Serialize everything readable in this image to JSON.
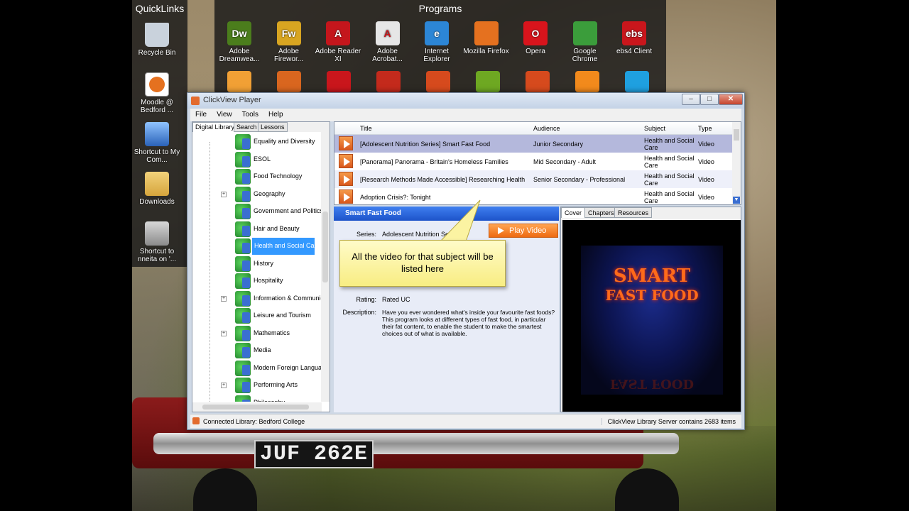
{
  "desktop": {
    "quicklinks": {
      "title": "QuickLinks",
      "items": [
        {
          "label": "Recycle Bin",
          "icon": "recycle-bin-icon"
        },
        {
          "label": "Moodle @ Bedford ...",
          "icon": "firefox-shortcut-icon"
        },
        {
          "label": "Shortcut to My Com...",
          "icon": "computer-icon"
        },
        {
          "label": "Downloads",
          "icon": "folder-icon"
        },
        {
          "label": "Shortcut to nneita on '...",
          "icon": "network-drive-icon"
        }
      ]
    },
    "programs": {
      "title": "Programs",
      "items": [
        {
          "label": "Adobe Dreamwea...",
          "icon": "dreamweaver-icon",
          "glyph": "Dw",
          "color": "#4b7d1c"
        },
        {
          "label": "Adobe Firewor...",
          "icon": "fireworks-icon",
          "glyph": "Fw",
          "color": "#d8a521"
        },
        {
          "label": "Adobe Reader XI",
          "icon": "adobe-reader-icon",
          "glyph": "A",
          "color": "#c4161c"
        },
        {
          "label": "Adobe Acrobat...",
          "icon": "adobe-acrobat-icon",
          "glyph": "A",
          "color": "#e6e6e6"
        },
        {
          "label": "Internet Explorer",
          "icon": "internet-explorer-icon",
          "glyph": "e",
          "color": "#2c86d6"
        },
        {
          "label": "Mozilla Firefox",
          "icon": "firefox-icon",
          "glyph": "",
          "color": "#e5711f"
        },
        {
          "label": "Opera",
          "icon": "opera-icon",
          "glyph": "O",
          "color": "#d8141c"
        },
        {
          "label": "Google Chrome",
          "icon": "chrome-icon",
          "glyph": "",
          "color": "#3b9d3b"
        },
        {
          "label": "ebs4 Client",
          "icon": "ebs4-icon",
          "glyph": "ebs",
          "color": "#c9161c"
        }
      ]
    },
    "plate": "JUF 262E"
  },
  "window": {
    "title": "ClickView Player",
    "controls": {
      "minimize": "–",
      "maximize": "□",
      "close": "✕"
    },
    "menu": [
      "File",
      "View",
      "Tools",
      "Help"
    ],
    "left_tabs": [
      "Digital Library",
      "Search",
      "Lessons"
    ],
    "tree_items": [
      {
        "label": "Equality and Diversity",
        "expander": ""
      },
      {
        "label": "ESOL",
        "expander": ""
      },
      {
        "label": "Food Technology",
        "expander": ""
      },
      {
        "label": "Geography",
        "expander": "+"
      },
      {
        "label": "Government and Politics",
        "expander": ""
      },
      {
        "label": "Hair and Beauty",
        "expander": ""
      },
      {
        "label": "Health and Social Care",
        "expander": "",
        "selected": true
      },
      {
        "label": "History",
        "expander": ""
      },
      {
        "label": "Hospitality",
        "expander": ""
      },
      {
        "label": "Information & Communicat",
        "expander": "+"
      },
      {
        "label": "Leisure and Tourism",
        "expander": ""
      },
      {
        "label": "Mathematics",
        "expander": "+"
      },
      {
        "label": "Media",
        "expander": ""
      },
      {
        "label": "Modern Foreign Language",
        "expander": ""
      },
      {
        "label": "Performing Arts",
        "expander": "+"
      },
      {
        "label": "Philosophy",
        "expander": ""
      }
    ],
    "grid": {
      "columns": [
        "Title",
        "Audience",
        "Subject",
        "Type"
      ],
      "rows": [
        {
          "title": "[Adolescent Nutrition Series] Smart Fast Food",
          "audience": "Junior Secondary",
          "subject": "Health and Social Care",
          "type": "Video",
          "selected": true
        },
        {
          "title": "[Panorama] Panorama - Britain's Homeless Families",
          "audience": "Mid Secondary - Adult",
          "subject": "Health and Social Care",
          "type": "Video"
        },
        {
          "title": "[Research Methods Made Accessible] Researching Health",
          "audience": "Senior Secondary - Professional",
          "subject": "Health and Social Care",
          "type": "Video"
        },
        {
          "title": "Adoption Crisis?: Tonight",
          "audience": "",
          "subject": "Health and Social Care",
          "type": "Video"
        }
      ]
    },
    "details": {
      "header": "Smart Fast Food",
      "series_label": "Series:",
      "series_value": "Adolescent Nutrition Se",
      "play_label": "Play Video",
      "rating_label": "Rating:",
      "rating_value": "Rated UC",
      "description_label": "Description:",
      "description_value": "Have you ever wondered what's inside your favourite fast foods? This program looks at different types of fast food, in particular their fat content, to enable the student to make the smartest choices out of what is available."
    },
    "callout": "All the video for that subject will be listed here",
    "cover_tabs": [
      "Cover",
      "Chapters",
      "Resources"
    ],
    "cover": {
      "line1": "SMART",
      "line2": "FAST FOOD"
    },
    "status": {
      "left": "Connected Library: Bedford College",
      "right": "ClickView Library Server contains 2683 items"
    }
  }
}
